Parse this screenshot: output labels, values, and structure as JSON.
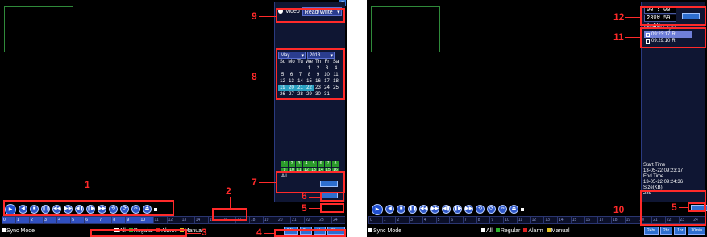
{
  "colors": {
    "accent": "#2e6fd0",
    "record_day": "#2aa0c0",
    "callout": "#ff2a2a"
  },
  "left": {
    "mode": {
      "label": "Video",
      "value": "Read/Write"
    },
    "calendar": {
      "month": "May",
      "year": "2013",
      "weekdays": [
        "Su",
        "Mo",
        "Tu",
        "We",
        "Th",
        "Fr",
        "Sa"
      ],
      "days": [
        "",
        "",
        "",
        "1",
        "2",
        "3",
        "4",
        "5",
        "6",
        "7",
        "8",
        "9",
        "10",
        "11",
        "12",
        "13",
        "14",
        "15",
        "16",
        "17",
        "18",
        "19",
        "20",
        "21",
        "22",
        "23",
        "24",
        "25",
        "26",
        "27",
        "28",
        "29",
        "30",
        "31"
      ],
      "recorded_days": [
        "19",
        "20",
        "21",
        "22"
      ]
    },
    "channels": [
      "1",
      "2",
      "3",
      "4",
      "5",
      "6",
      "7",
      "8",
      "9",
      "10",
      "11",
      "12",
      "13",
      "14",
      "15",
      "16"
    ],
    "channel_all": "All"
  },
  "right": {
    "time_start": "00 : 00 : 00",
    "time_end": "23 : 59 : 59",
    "list_header": "StartTime  Type",
    "files": [
      {
        "time": "09:23:17",
        "type": "R"
      },
      {
        "time": "09:29:10",
        "type": "R"
      }
    ],
    "info": {
      "start_label": "Start Time",
      "start_value": "13-05-22 09:23:17",
      "end_label": "End Time",
      "end_value": "13-05-22 09:24:36",
      "size_label": "Size(KB)",
      "size_value": "289"
    }
  },
  "controls": [
    "▶",
    "◀",
    "■",
    "❚❚",
    "◀◀",
    "▶▶",
    "◀❚",
    "❚▶",
    "▶▶",
    "⟲",
    "⟳",
    "✂",
    "⏏"
  ],
  "timeline": [
    "0",
    "1",
    "2",
    "3",
    "4",
    "5",
    "6",
    "7",
    "8",
    "9",
    "10",
    "11",
    "12",
    "13",
    "14",
    "15",
    "16",
    "17",
    "18",
    "19",
    "20",
    "21",
    "22",
    "23",
    "24"
  ],
  "bottom": {
    "sync_label": "Sync Mode",
    "legend": {
      "all": "All",
      "regular": "Regular",
      "alarm": "Alarm",
      "manual": "Manual"
    },
    "speeds": [
      "24hr",
      "2hr",
      "1hr",
      "30min"
    ]
  },
  "callouts": [
    "1",
    "2",
    "3",
    "4",
    "5",
    "6",
    "7",
    "8",
    "9",
    "10",
    "11",
    "12",
    "5"
  ]
}
